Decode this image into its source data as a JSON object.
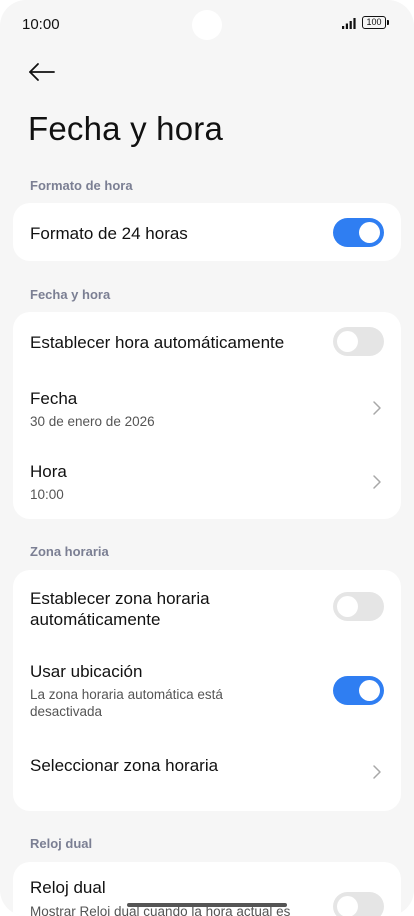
{
  "status_bar": {
    "time": "10:00",
    "battery": "100",
    "signal_icon": "signal-bars-icon",
    "battery_icon": "battery-icon"
  },
  "header": {
    "back_icon": "arrow-left-icon",
    "title": "Fecha y hora"
  },
  "sections": {
    "time_format": {
      "header": "Formato de hora",
      "toggle_24h": {
        "label": "Formato de 24 horas",
        "on": true
      }
    },
    "date_time": {
      "header": "Fecha y hora",
      "auto_time": {
        "label": "Establecer hora automáticamente",
        "on": false
      },
      "date": {
        "label": "Fecha",
        "value": "30 de enero de 2026"
      },
      "time": {
        "label": "Hora",
        "value": "10:00"
      }
    },
    "timezone": {
      "header": "Zona horaria",
      "auto_timezone": {
        "label": "Establecer zona horaria automáticamente",
        "on": false
      },
      "use_location": {
        "label": "Usar ubicación",
        "description": "La zona horaria automática está desactivada",
        "on": true
      },
      "select_timezone": {
        "label": "Seleccionar zona horaria"
      }
    },
    "dual_clock": {
      "header": "Reloj dual",
      "dual_clock": {
        "label": "Reloj dual",
        "description": "Mostrar Reloj dual cuando la hora actual es",
        "on": false
      }
    }
  },
  "colors": {
    "accent": "#2f7ef2",
    "toggle_off": "#e5e5e5",
    "background": "#f6f6f6",
    "section_header": "#7b7f93"
  }
}
